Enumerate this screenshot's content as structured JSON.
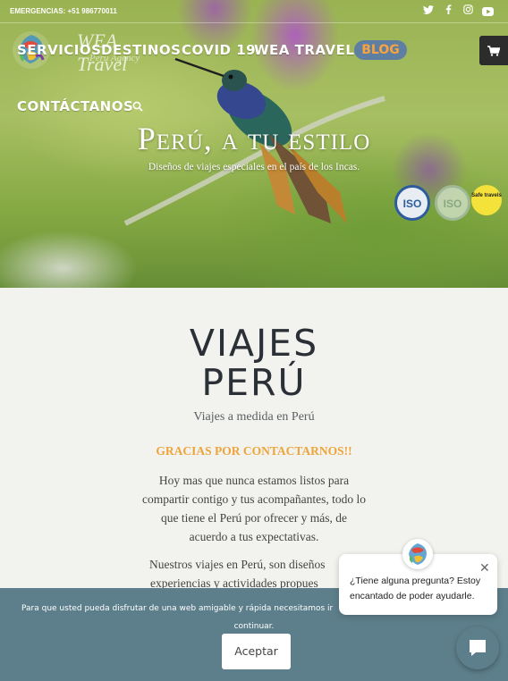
{
  "topbar": {
    "emergency": "EMERGENCIAS: +51 986770011",
    "social_icons": [
      "twitter-icon",
      "facebook-icon",
      "instagram-icon",
      "youtube-icon"
    ]
  },
  "logo": {
    "text": "WEA Travel",
    "subtext": "Peru Agency"
  },
  "nav": {
    "items": [
      "SERVICIOS",
      "DESTINOS",
      "COVID 19",
      "WEA TRAVEL",
      "BLOG",
      "CONTÁCTANOS"
    ],
    "blog_color": "#f7a33f",
    "blog_bg": "#5e7ea2"
  },
  "hero": {
    "title": "Perú, a tu estilo",
    "subtitle": "Diseños de viajes especiales en el país de los Incas.",
    "badges": [
      "ISO",
      "ISO",
      "Safe travels"
    ]
  },
  "content": {
    "title_line1": "VIAJES",
    "title_line2": "PERÚ",
    "subtitle": "Viajes a medida en Perú",
    "thanks": "GRACIAS POR CONTACTARNOS!!",
    "paragraph1": [
      "Hoy mas que nunca estamos listos para",
      "compartir contigo y tus acompañantes, todo lo",
      "que tiene el Perú por ofrecer y más,  de",
      "acuerdo a tus expectativas."
    ],
    "paragraph2": [
      "Nuestros viajes en Perú, son diseños",
      "experiencias y actividades  propues"
    ]
  },
  "cookie": {
    "text_line1": "Para que usted pueda disfrutar de una web amigable y rápida necesitamos ir",
    "text_line2": "continuar.",
    "accept_label": "Aceptar"
  },
  "chat": {
    "message_line1": "¿Tiene alguna pregunta? Estoy",
    "message_line2": "encantado de poder ayudarle."
  },
  "colors": {
    "accent_orange": "#eda53b",
    "cookie_bg": "#5d7f8b",
    "title_dark": "#2b2f36"
  }
}
